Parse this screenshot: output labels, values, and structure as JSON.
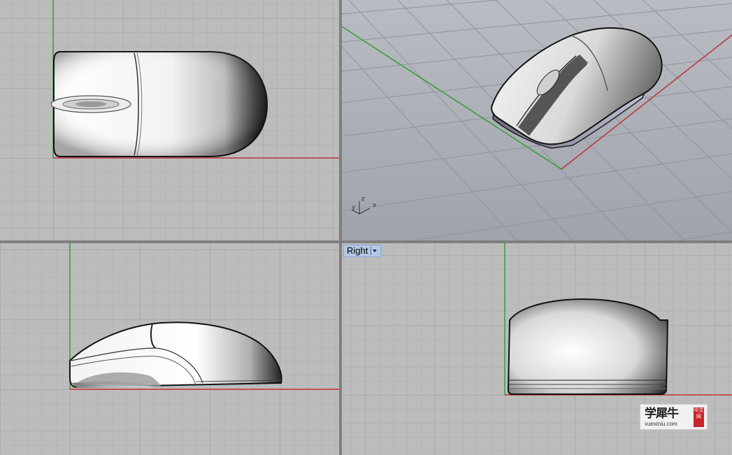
{
  "viewports": {
    "top": {
      "name": ""
    },
    "perspective": {
      "name": "",
      "axis_x": "x",
      "axis_y": "y",
      "axis_z": "z"
    },
    "front": {
      "name": ""
    },
    "right": {
      "name": "Right"
    }
  },
  "watermark": {
    "title": "学犀牛",
    "url": "xuexiniu.com",
    "badge": "中文网"
  },
  "colors": {
    "x_axis": "#c03232",
    "y_axis": "#2ea02e",
    "grid_major": "#9c9c9c",
    "grid_minor": "#adadad",
    "label_bg": "#b4c8e6"
  },
  "icons": [
    "dropdown-arrow-icon",
    "axes-gizmo-icon"
  ]
}
